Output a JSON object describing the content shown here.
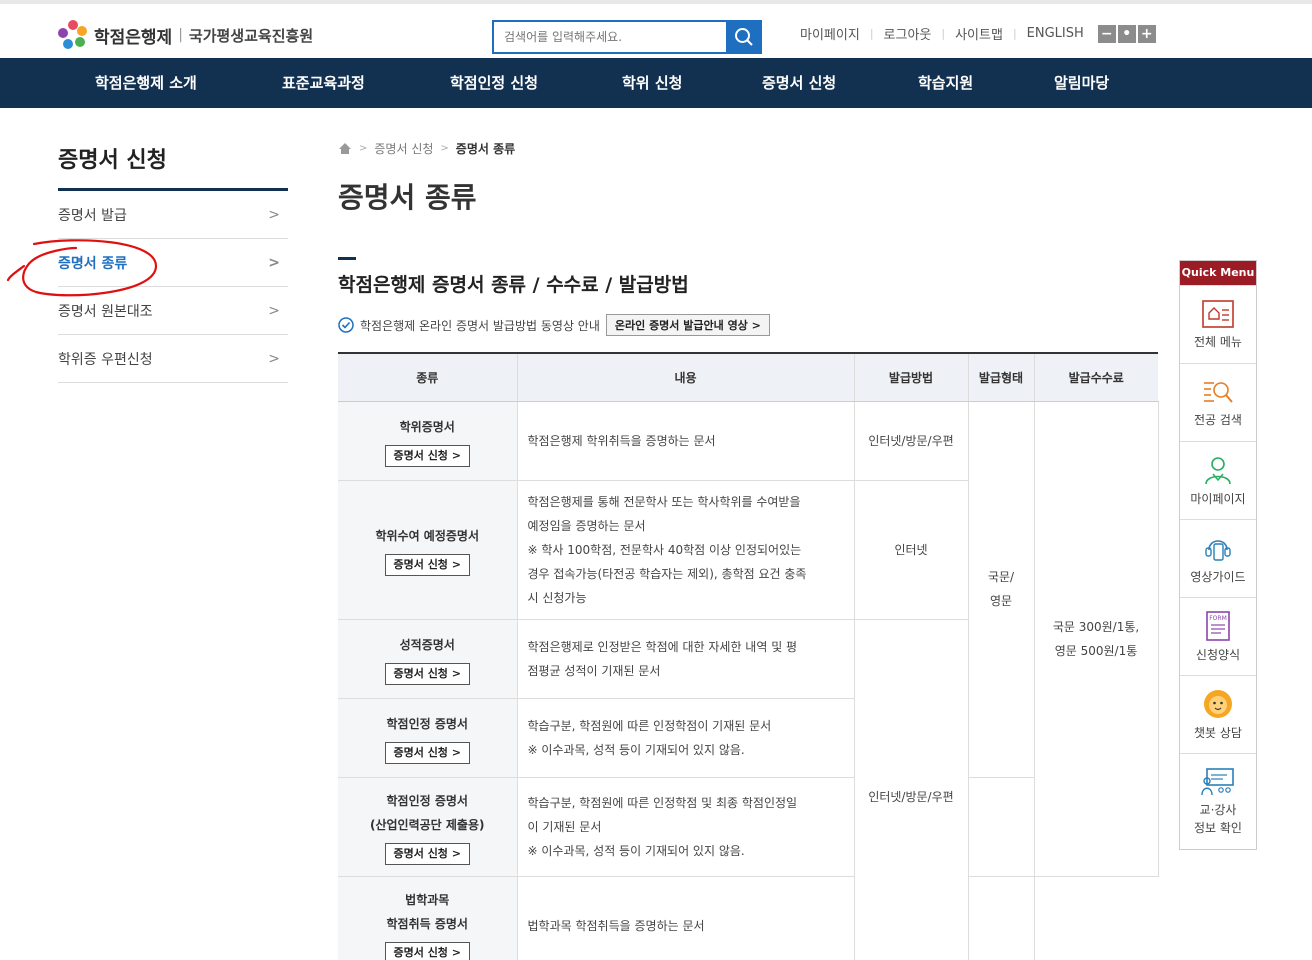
{
  "header": {
    "logo_main": "학점은행제",
    "logo_sep": "|",
    "logo_org": "국가평생교육진흥원",
    "search_placeholder": "검색어를 입력해주세요.",
    "util": [
      "마이페이지",
      "로그아웃",
      "사이트맵",
      "ENGLISH"
    ]
  },
  "gnb": [
    "학점은행제 소개",
    "표준교육과정",
    "학점인정 신청",
    "학위 신청",
    "증명서 신청",
    "학습지원",
    "알림마당"
  ],
  "lnb": {
    "title": "증명서 신청",
    "items": [
      "증명서 발급",
      "증명서 종류",
      "증명서 원본대조",
      "학위증 우편신청"
    ]
  },
  "breadcrumb": [
    "증명서 신청",
    "증명서 종류"
  ],
  "page_title": "증명서 종류",
  "section_title": "학점은행제 증명서 종류 / 수수료 / 발급방법",
  "guide": {
    "text": "학점은행제 온라인 증명서 발급방법 동영상 안내",
    "button": "온라인 증명서 발급안내 영상"
  },
  "table": {
    "headers": [
      "종류",
      "내용",
      "발급방법",
      "발급형태",
      "발급수수료"
    ],
    "apply_label": "증명서 신청",
    "rows": [
      {
        "kind": "학위증명서",
        "desc1": "학점은행제 학위취득을 증명하는 문서",
        "desc2": "",
        "desc3": "",
        "desc4": "",
        "desc5": ""
      },
      {
        "kind": "학위수여 예정증명서",
        "desc1": "학점은행제를 통해 전문학사 또는 학사학위를 수여받을",
        "desc2": "예정임을 증명하는 문서",
        "desc3": "※ 학사 100학점, 전문학사 40학점 이상 인정되어있는",
        "desc4": "경우 접속가능(타전공 학습자는 제외), 총학점 요건 충족",
        "desc5": "시 신청가능"
      },
      {
        "kind": "성적증명서",
        "desc1": "학점은행제로 인정받은 학점에 대한 자세한 내역 및 평",
        "desc2": "점평균 성적이 기재된 문서",
        "desc3": "",
        "desc4": "",
        "desc5": ""
      },
      {
        "kind": "학점인정 증명서",
        "desc1": "학습구분, 학점원에 따른 인정학점이 기재된 문서",
        "desc2": "※ 이수과목, 성적 등이 기재되어 있지 않음.",
        "desc3": "",
        "desc4": "",
        "desc5": ""
      },
      {
        "kind": "학점인정 증명서",
        "kind2": "(산업인력공단 제출용)",
        "desc1": "학습구분, 학점원에 따른 인정학점 및 최종 학점인정일",
        "desc2": "이 기재된 문서",
        "desc3": "※ 이수과목, 성적 등이 기재되어 있지 않음.",
        "desc4": "",
        "desc5": ""
      },
      {
        "kind": "법학과목",
        "kind2": "학점취득 증명서",
        "desc1": "법학과목 학점취득을 증명하는 문서",
        "desc2": "",
        "desc3": "",
        "desc4": "",
        "desc5": ""
      }
    ],
    "method_1": "인터넷/방문/우편",
    "method_2": "인터넷",
    "method_3": "인터넷/방문/우편",
    "form_1": "국문/",
    "form_2": "영문",
    "fee_1": "국문 300원/1통,",
    "fee_2": "영문 500원/1통"
  },
  "quick_menu": {
    "title": "Quick Menu",
    "items": [
      "전체 메뉴",
      "전공 검색",
      "마이페이지",
      "영상가이드",
      "신청양식",
      "챗봇 상담",
      "교·강사",
      "정보 확인"
    ],
    "form_icon_text": "FORM"
  },
  "colors": {
    "navy": "#123151",
    "blue": "#1f6fc0",
    "quick_red": "#9b1c24",
    "annotation_red": "#e01010"
  }
}
